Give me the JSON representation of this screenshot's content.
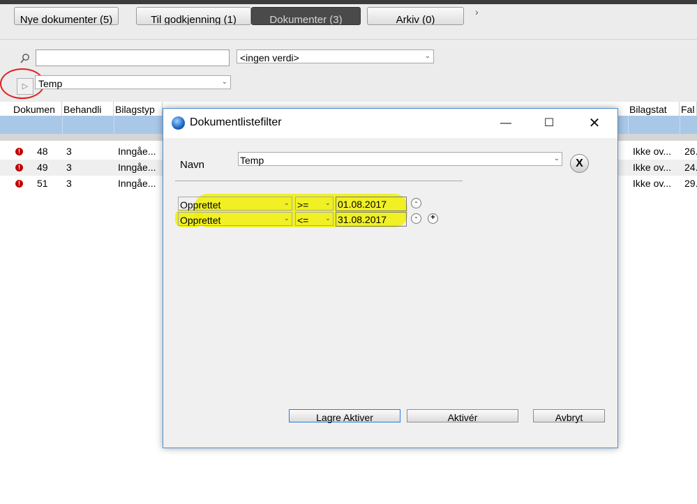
{
  "tabs": [
    {
      "label": "Nye dokumenter (5)",
      "active": false
    },
    {
      "label": "Til godkjenning (1)",
      "active": false
    },
    {
      "label": "Dokumenter (3)",
      "active": true
    },
    {
      "label": "Arkiv (0)",
      "active": false
    }
  ],
  "search": {
    "value": "",
    "filter_value": "<ingen verdi>"
  },
  "active_filter": "Temp",
  "columns": [
    "Dokumen",
    "Behandli",
    "Bilagstyp",
    "",
    "",
    "",
    "",
    "",
    "",
    "",
    "",
    "",
    "Bilagstat",
    "Fal"
  ],
  "rows": [
    {
      "id": "48",
      "behandling": "3",
      "bilagstype": "Inngåe...",
      "bilagstatus": "Ikke ov...",
      "fal": "26."
    },
    {
      "id": "49",
      "behandling": "3",
      "bilagstype": "Inngåe...",
      "bilagstatus": "Ikke ov...",
      "fal": "24."
    },
    {
      "id": "51",
      "behandling": "3",
      "bilagstype": "Inngåe...",
      "bilagstatus": "Ikke ov...",
      "fal": "29."
    }
  ],
  "dialog": {
    "title": "Dokumentlistefilter",
    "navn_label": "Navn",
    "navn_value": "Temp",
    "clear_label": "X",
    "criteria": [
      {
        "field": "Opprettet",
        "operator": ">=",
        "value": "01.08.2017"
      },
      {
        "field": "Opprettet",
        "operator": "<=",
        "value": "31.08.2017"
      }
    ],
    "buttons": {
      "save_activate": "Lagre  Aktiver",
      "activate": "Aktivér",
      "cancel": "Avbryt"
    }
  },
  "colors": {
    "highlight": "#f0f000",
    "header_blue": "#a9c8e8",
    "annotation": "#e02020"
  }
}
